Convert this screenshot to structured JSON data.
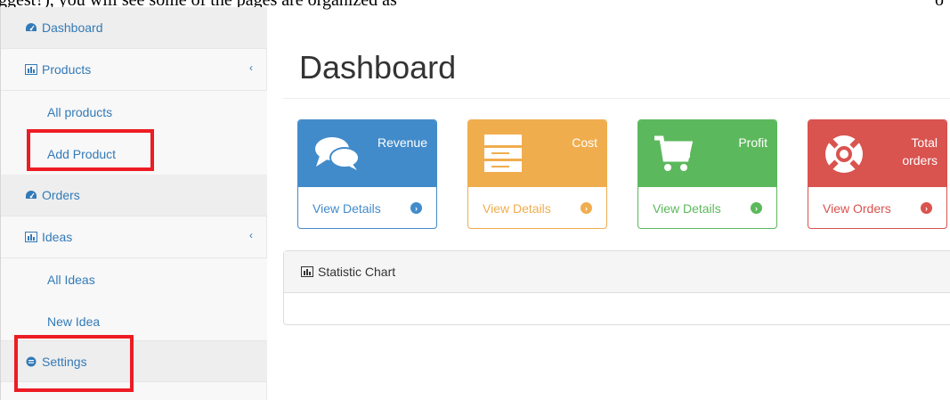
{
  "top_clipped_text": {
    "left": "ggest?), you will see some of the pages are organized as",
    "right": "o"
  },
  "sidebar": {
    "items": [
      {
        "label": "Dashboard",
        "icon": "dashboard-icon"
      },
      {
        "label": "Products",
        "icon": "bar-chart-icon",
        "chevron": "‹"
      },
      {
        "label": "All products"
      },
      {
        "label": "Add Product"
      },
      {
        "label": "Orders",
        "icon": "dashboard-icon"
      },
      {
        "label": "Ideas",
        "icon": "bar-chart-icon",
        "chevron": "‹"
      },
      {
        "label": "All Ideas"
      },
      {
        "label": "New Idea"
      },
      {
        "label": "Settings",
        "icon": "settings-icon"
      }
    ]
  },
  "main": {
    "title": "Dashboard",
    "panels": [
      {
        "title": "Revenue",
        "link": "View Details",
        "icon": "comments-icon",
        "color": "#428bca"
      },
      {
        "title": "Cost",
        "link": "View Details",
        "icon": "server-icon",
        "color": "#f0ad4e"
      },
      {
        "title": "Profit",
        "link": "View Details",
        "icon": "shopping-cart-icon",
        "color": "#5cb85c"
      },
      {
        "title_line1": "Total",
        "title_line2": "orders",
        "link": "View Orders",
        "icon": "life-ring-icon",
        "color": "#d9534f"
      }
    ],
    "chart_panel": {
      "title": "Statistic Chart",
      "icon": "bar-chart-icon"
    }
  },
  "colors": {
    "highlight": "#ed1c24",
    "link": "#337ab7"
  }
}
